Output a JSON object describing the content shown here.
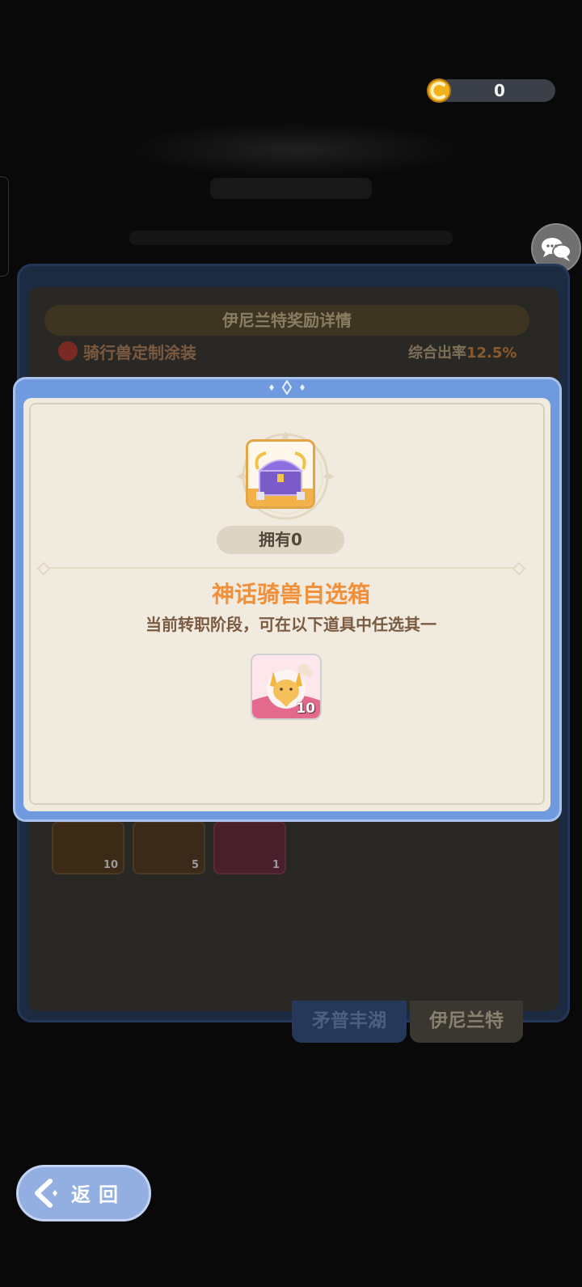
{
  "currency": {
    "icon": "gold-horseshoe-icon",
    "value": "0"
  },
  "background": {
    "panel_header": "伊尼兰特奖励详情",
    "reward_row": {
      "label": "骑行兽定制涂装",
      "rate_label": "综合出率",
      "rate_value": "12.5%"
    },
    "tiles": [
      {
        "count": "10"
      },
      {
        "count": "5"
      },
      {
        "count": "1"
      }
    ],
    "tabs": [
      {
        "label": "矛普丰湖"
      },
      {
        "label": "伊尼兰特"
      }
    ]
  },
  "modal": {
    "owned_label": "拥有0",
    "item_title": "神话骑兽自选箱",
    "item_desc": "当前转职阶段，可在以下道具中任选其一",
    "reward": {
      "icon": "fox-mount-icon",
      "count": "10"
    }
  },
  "back_button": {
    "label": "返回"
  },
  "colors": {
    "accent_orange": "#f2903a",
    "modal_blue": "#6f9ae0",
    "paper": "#f1ebdf"
  }
}
